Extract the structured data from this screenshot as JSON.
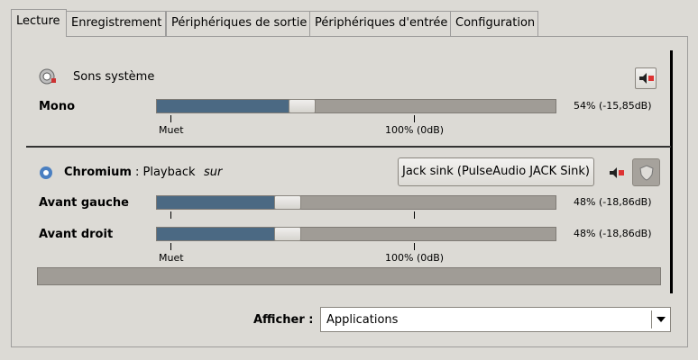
{
  "tabs": [
    "Lecture",
    "Enregistrement",
    "Périphériques de sortie",
    "Périphériques d'entrée",
    "Configuration"
  ],
  "system_sounds": {
    "title": "Sons système",
    "icon": "speaker-icon",
    "channel_label": "Mono",
    "volume_text": "54% (-15,85dB)",
    "volume_fraction": 0.54
  },
  "scale": {
    "mute_label": "Muet",
    "full_label": "100% (0dB)"
  },
  "stream": {
    "app_name": "Chromium",
    "kind": ": Playback",
    "on_label": "sur",
    "icon": "chromium-icon",
    "device_button": "Jack sink (PulseAudio JACK Sink)",
    "channels": [
      {
        "label": "Avant gauche",
        "volume_text": "48% (-18,86dB)",
        "volume_fraction": 0.48
      },
      {
        "label": "Avant droit",
        "volume_text": "48% (-18,86dB)",
        "volume_fraction": 0.48
      }
    ]
  },
  "footer": {
    "show_label": "Afficher :",
    "show_value": "Applications"
  },
  "colors": {
    "fill": "#4b6983",
    "trough": "#a09c96",
    "background": "#dcdad5"
  }
}
